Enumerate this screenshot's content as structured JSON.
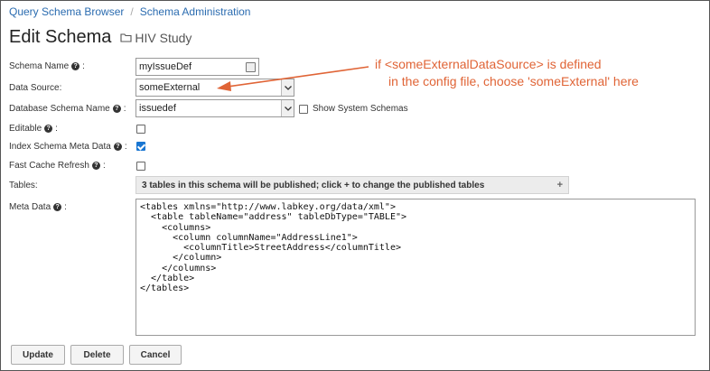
{
  "breadcrumb": {
    "items": [
      "Query Schema Browser",
      "Schema Administration"
    ],
    "separator": "/"
  },
  "page": {
    "title": "Edit Schema",
    "folder_name": "HIV Study"
  },
  "form": {
    "schema_name": {
      "label": "Schema Name",
      "value": "myIssueDef"
    },
    "data_source": {
      "label": "Data Source:",
      "value": "someExternal"
    },
    "database_schema_name": {
      "label": "Database Schema Name",
      "value": "issuedef",
      "show_system_label": "Show System Schemas",
      "show_system_checked": false
    },
    "editable": {
      "label": "Editable",
      "checked": false
    },
    "index_meta": {
      "label": "Index Schema Meta Data",
      "checked": true
    },
    "fast_cache": {
      "label": "Fast Cache Refresh",
      "checked": false
    },
    "tables": {
      "label": "Tables:",
      "summary": "3 tables in this schema will be published; click + to change the published tables",
      "expand_symbol": "+"
    },
    "meta_data": {
      "label": "Meta Data",
      "value": "<tables xmlns=\"http://www.labkey.org/data/xml\">\n  <table tableName=\"address\" tableDbType=\"TABLE\">\n    <columns>\n      <column columnName=\"AddressLine1\">\n        <columnTitle>StreetAddress</columnTitle>\n      </column>\n    </columns>\n  </table>\n</tables>"
    }
  },
  "buttons": {
    "update": "Update",
    "delete": "Delete",
    "cancel": "Cancel"
  },
  "annotation": {
    "line1": "if <someExternalDataSource> is defined",
    "line2": "in the config file,  choose 'someExternal' here",
    "color": "#e06436"
  },
  "colors": {
    "link": "#2b6cb0",
    "checkbox_checked": "#1976d2"
  },
  "icons": {
    "folder": "folder-icon",
    "help": "help-icon",
    "dropdown": "chevron-down-icon"
  }
}
